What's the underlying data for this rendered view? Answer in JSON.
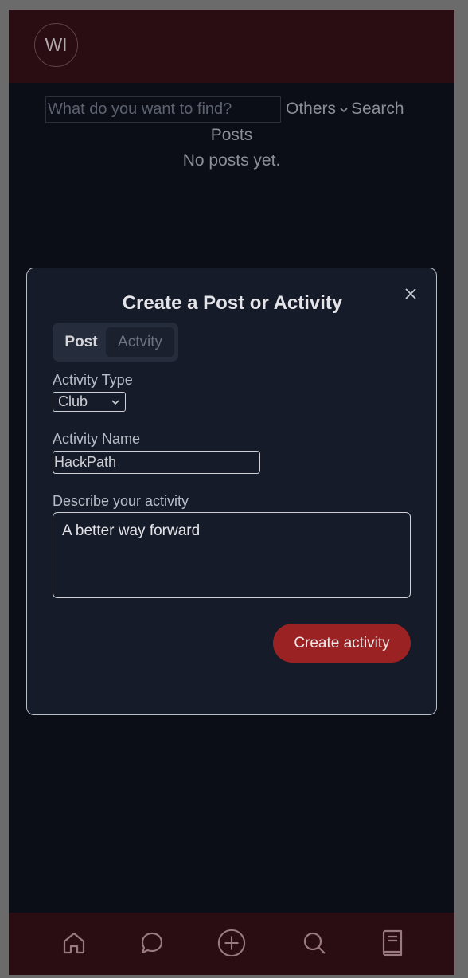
{
  "header": {
    "avatar_initials": "WI"
  },
  "search": {
    "placeholder": "What do you want to find?",
    "filter_label": "Others",
    "search_label": "Search"
  },
  "feed": {
    "heading": "Posts",
    "empty_text": "No posts yet."
  },
  "modal": {
    "title": "Create a Post or Activity",
    "tabs": [
      {
        "label": "Post",
        "active": false
      },
      {
        "label": "Actvity",
        "active": true
      }
    ],
    "activity_type_label": "Activity Type",
    "activity_type_value": "Club",
    "activity_name_label": "Activity Name",
    "activity_name_value": "HackPath",
    "description_label": "Describe your activity",
    "description_value": "A better way forward",
    "submit_label": "Create activity"
  },
  "bottom_nav": {
    "icons": [
      "home-icon",
      "chat-icon",
      "add-icon",
      "search-icon",
      "book-icon"
    ]
  },
  "colors": {
    "header_bg": "#2a0d12",
    "page_bg": "#0b0e16",
    "modal_bg": "#151b29",
    "accent": "#9b2222"
  }
}
